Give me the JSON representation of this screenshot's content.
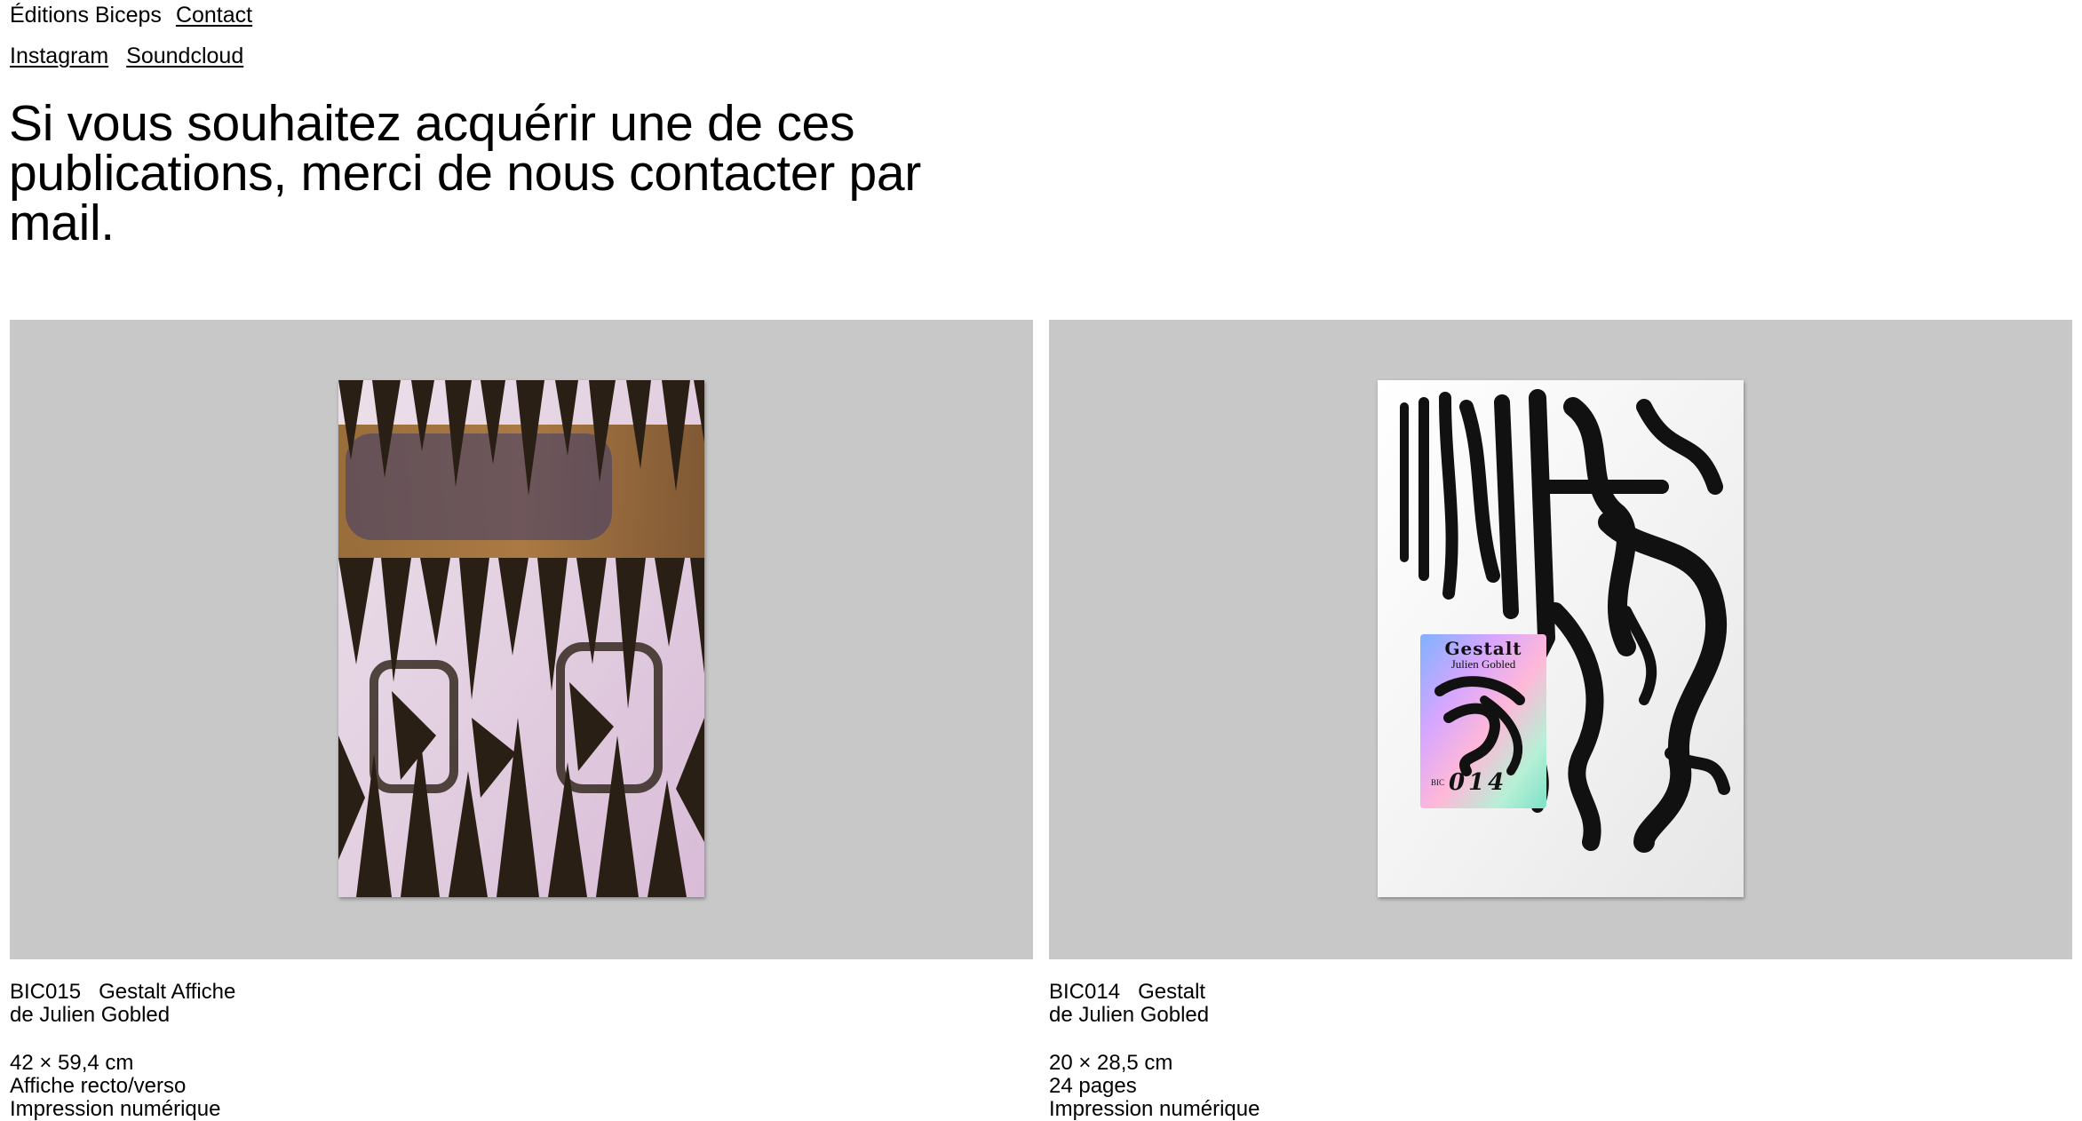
{
  "header": {
    "site_name": "Éditions Biceps",
    "contact_link": "Contact",
    "social_links": [
      "Instagram",
      "Soundcloud"
    ]
  },
  "intro": {
    "text": "Si vous souhaitez acquérir une de ces publications, merci de nous contacter par mail."
  },
  "publications": [
    {
      "ref": "BIC015",
      "title": "Gestalt Affiche",
      "author": "de Julien Gobled",
      "size": "42 × 59,4 cm",
      "format": "Affiche recto/verso",
      "print": "Impression numérique"
    },
    {
      "ref": "BIC014",
      "title": "Gestalt",
      "author": "de Julien Gobled",
      "size": "20 × 28,5 cm",
      "format": "24 pages",
      "print": "Impression numérique",
      "cover_sticker": {
        "title": "Gestalt",
        "author": "Julien Gobled",
        "prefix": "BIC",
        "number": "014"
      }
    }
  ],
  "colors": {
    "frame_background": "#c8c8c8",
    "poster_dark": "#2a1f14",
    "poster_light": "#e8d8e6",
    "poster_accent": "#8a5a1c"
  }
}
